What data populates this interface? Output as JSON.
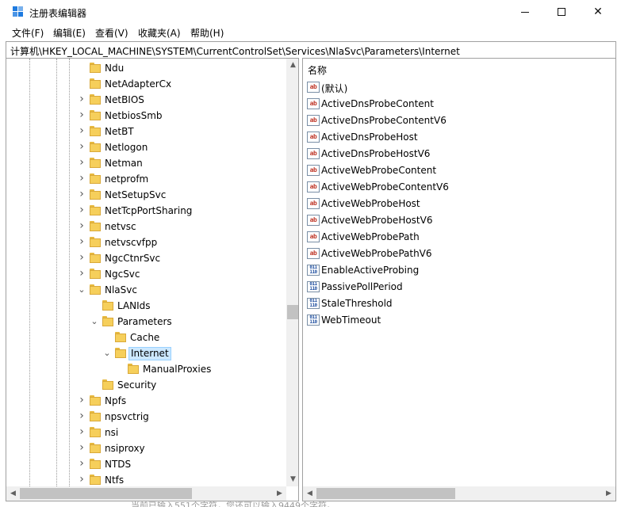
{
  "window": {
    "title": "注册表编辑器",
    "minimize_glyph": "",
    "maximize_glyph": "",
    "close_glyph": "✕",
    "accent_color": "#1e7be0"
  },
  "menu": {
    "file": "文件(F)",
    "edit": "编辑(E)",
    "view": "查看(V)",
    "favorites": "收藏夹(A)",
    "help": "帮助(H)"
  },
  "address": {
    "path": "计算机\\HKEY_LOCAL_MACHINE\\SYSTEM\\CurrentControlSet\\Services\\NlaSvc\\Parameters\\Internet"
  },
  "tree": {
    "selection_color": "#cce8ff",
    "items": [
      {
        "label": "Ndu",
        "level": 0,
        "state": "none"
      },
      {
        "label": "NetAdapterCx",
        "level": 0,
        "state": "none"
      },
      {
        "label": "NetBIOS",
        "level": 0,
        "state": "collapsed"
      },
      {
        "label": "NetbiosSmb",
        "level": 0,
        "state": "collapsed"
      },
      {
        "label": "NetBT",
        "level": 0,
        "state": "collapsed"
      },
      {
        "label": "Netlogon",
        "level": 0,
        "state": "collapsed"
      },
      {
        "label": "Netman",
        "level": 0,
        "state": "collapsed"
      },
      {
        "label": "netprofm",
        "level": 0,
        "state": "collapsed"
      },
      {
        "label": "NetSetupSvc",
        "level": 0,
        "state": "collapsed"
      },
      {
        "label": "NetTcpPortSharing",
        "level": 0,
        "state": "collapsed"
      },
      {
        "label": "netvsc",
        "level": 0,
        "state": "collapsed"
      },
      {
        "label": "netvscvfpp",
        "level": 0,
        "state": "collapsed"
      },
      {
        "label": "NgcCtnrSvc",
        "level": 0,
        "state": "collapsed"
      },
      {
        "label": "NgcSvc",
        "level": 0,
        "state": "collapsed"
      },
      {
        "label": "NlaSvc",
        "level": 0,
        "state": "expanded"
      },
      {
        "label": "LANIds",
        "level": 1,
        "state": "none"
      },
      {
        "label": "Parameters",
        "level": 1,
        "state": "expanded"
      },
      {
        "label": "Cache",
        "level": 2,
        "state": "none"
      },
      {
        "label": "Internet",
        "level": 2,
        "state": "expanded",
        "selected": true
      },
      {
        "label": "ManualProxies",
        "level": 3,
        "state": "none"
      },
      {
        "label": "Security",
        "level": 1,
        "state": "none"
      },
      {
        "label": "Npfs",
        "level": 0,
        "state": "collapsed"
      },
      {
        "label": "npsvctrig",
        "level": 0,
        "state": "collapsed"
      },
      {
        "label": "nsi",
        "level": 0,
        "state": "collapsed"
      },
      {
        "label": "nsiproxy",
        "level": 0,
        "state": "collapsed"
      },
      {
        "label": "NTDS",
        "level": 0,
        "state": "collapsed"
      },
      {
        "label": "Ntfs",
        "level": 0,
        "state": "collapsed"
      }
    ]
  },
  "values": {
    "column_name": "名称",
    "items": [
      {
        "name": "(默认)",
        "icon": "string-value-icon",
        "badge": "ab"
      },
      {
        "name": "ActiveDnsProbeContent",
        "icon": "string-value-icon",
        "badge": "ab"
      },
      {
        "name": "ActiveDnsProbeContentV6",
        "icon": "string-value-icon",
        "badge": "ab"
      },
      {
        "name": "ActiveDnsProbeHost",
        "icon": "string-value-icon",
        "badge": "ab"
      },
      {
        "name": "ActiveDnsProbeHostV6",
        "icon": "string-value-icon",
        "badge": "ab"
      },
      {
        "name": "ActiveWebProbeContent",
        "icon": "string-value-icon",
        "badge": "ab"
      },
      {
        "name": "ActiveWebProbeContentV6",
        "icon": "string-value-icon",
        "badge": "ab"
      },
      {
        "name": "ActiveWebProbeHost",
        "icon": "string-value-icon",
        "badge": "ab"
      },
      {
        "name": "ActiveWebProbeHostV6",
        "icon": "string-value-icon",
        "badge": "ab"
      },
      {
        "name": "ActiveWebProbePath",
        "icon": "string-value-icon",
        "badge": "ab"
      },
      {
        "name": "ActiveWebProbePathV6",
        "icon": "string-value-icon",
        "badge": "ab"
      },
      {
        "name": "EnableActiveProbing",
        "icon": "dword-value-icon",
        "badge": "011\n110"
      },
      {
        "name": "PassivePollPeriod",
        "icon": "dword-value-icon",
        "badge": "011\n110"
      },
      {
        "name": "StaleThreshold",
        "icon": "dword-value-icon",
        "badge": "011\n110"
      },
      {
        "name": "WebTimeout",
        "icon": "dword-value-icon",
        "badge": "011\n110"
      }
    ]
  },
  "status": {
    "ghost_text": "当前已输入551个字符，您还可以输入9449个字符。"
  }
}
